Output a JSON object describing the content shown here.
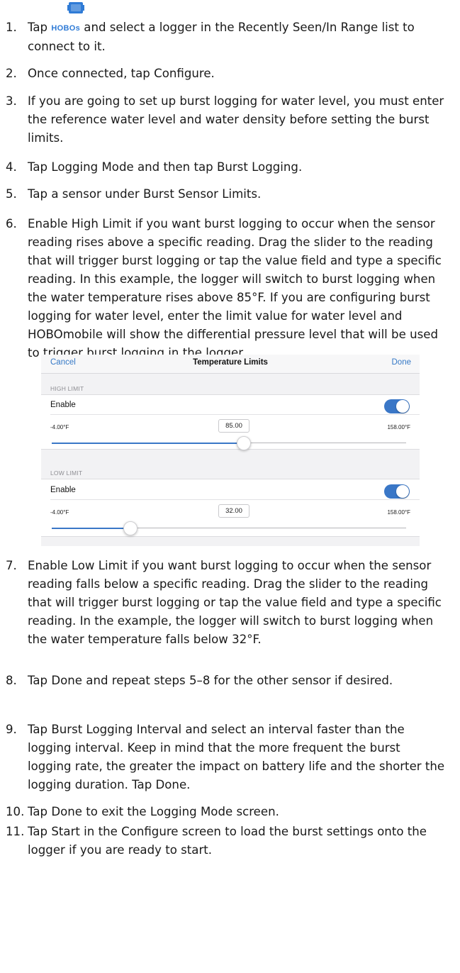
{
  "steps": [
    {
      "num": "1.",
      "pre": "Tap",
      "icon_word": "HOBOs",
      "post": "and select a logger in the Recently Seen/In Range list to connect to it."
    },
    {
      "num": "2.",
      "text": "Once connected, tap Configure."
    },
    {
      "num": "3.",
      "text": "If you are going to set up burst logging for water level, you must enter the reference water level and water density before setting the burst limits."
    },
    {
      "num": "4.",
      "text": "Tap Logging Mode and then tap Burst Logging."
    },
    {
      "num": "5.",
      "text": "Tap a sensor under Burst Sensor Limits."
    },
    {
      "num": "6.",
      "text": "Enable High Limit if you want burst logging to occur when the sensor reading rises above a specific reading. Drag the slider to the reading that will trigger burst logging or tap the value field and type a specific reading. In this example, the logger will switch to burst logging when the water temperature rises above 85°F. If you are configuring burst logging for water level, enter the limit value for water level and HOBOmobile will show the differential pressure level that will be used to trigger burst logging in the logger."
    },
    {
      "num": "7.",
      "text": "Enable Low Limit if you want burst logging to occur when the sensor reading falls below a specific reading. Drag the slider to the reading that will trigger burst logging or tap the value field and type a specific reading. In the example, the logger will switch to burst logging when the water temperature falls below 32°F."
    },
    {
      "num": "8.",
      "text": "Tap Done and repeat steps 5–8 for the other sensor if desired."
    },
    {
      "num": "9.",
      "text": "Tap Burst Logging Interval and select an interval faster than the logging interval. Keep in mind that the more frequent the burst logging rate, the greater the impact on battery life and the shorter the logging duration. Tap Done."
    },
    {
      "num": "10.",
      "text": "Tap Done to exit the Logging Mode screen."
    },
    {
      "num": "11.",
      "text": "Tap Start in the Configure screen to load the burst settings onto the logger if you are ready to start."
    }
  ],
  "screenshot": {
    "cancel": "Cancel",
    "title": "Temperature Limits",
    "done": "Done",
    "high": {
      "header": "HIGH LIMIT",
      "enable": "Enable",
      "min": "-4.00°F",
      "max": "158.00°F",
      "value": "85.00",
      "fraction": 0.54
    },
    "low": {
      "header": "LOW LIMIT",
      "enable": "Enable",
      "min": "-4.00°F",
      "max": "158.00°F",
      "value": "32.00",
      "fraction": 0.22
    }
  },
  "colors": {
    "accent": "#3a77c7",
    "link": "#3478c6"
  },
  "icons": {
    "hobos": "hobos-logger-icon",
    "toggle": "toggle-on"
  }
}
